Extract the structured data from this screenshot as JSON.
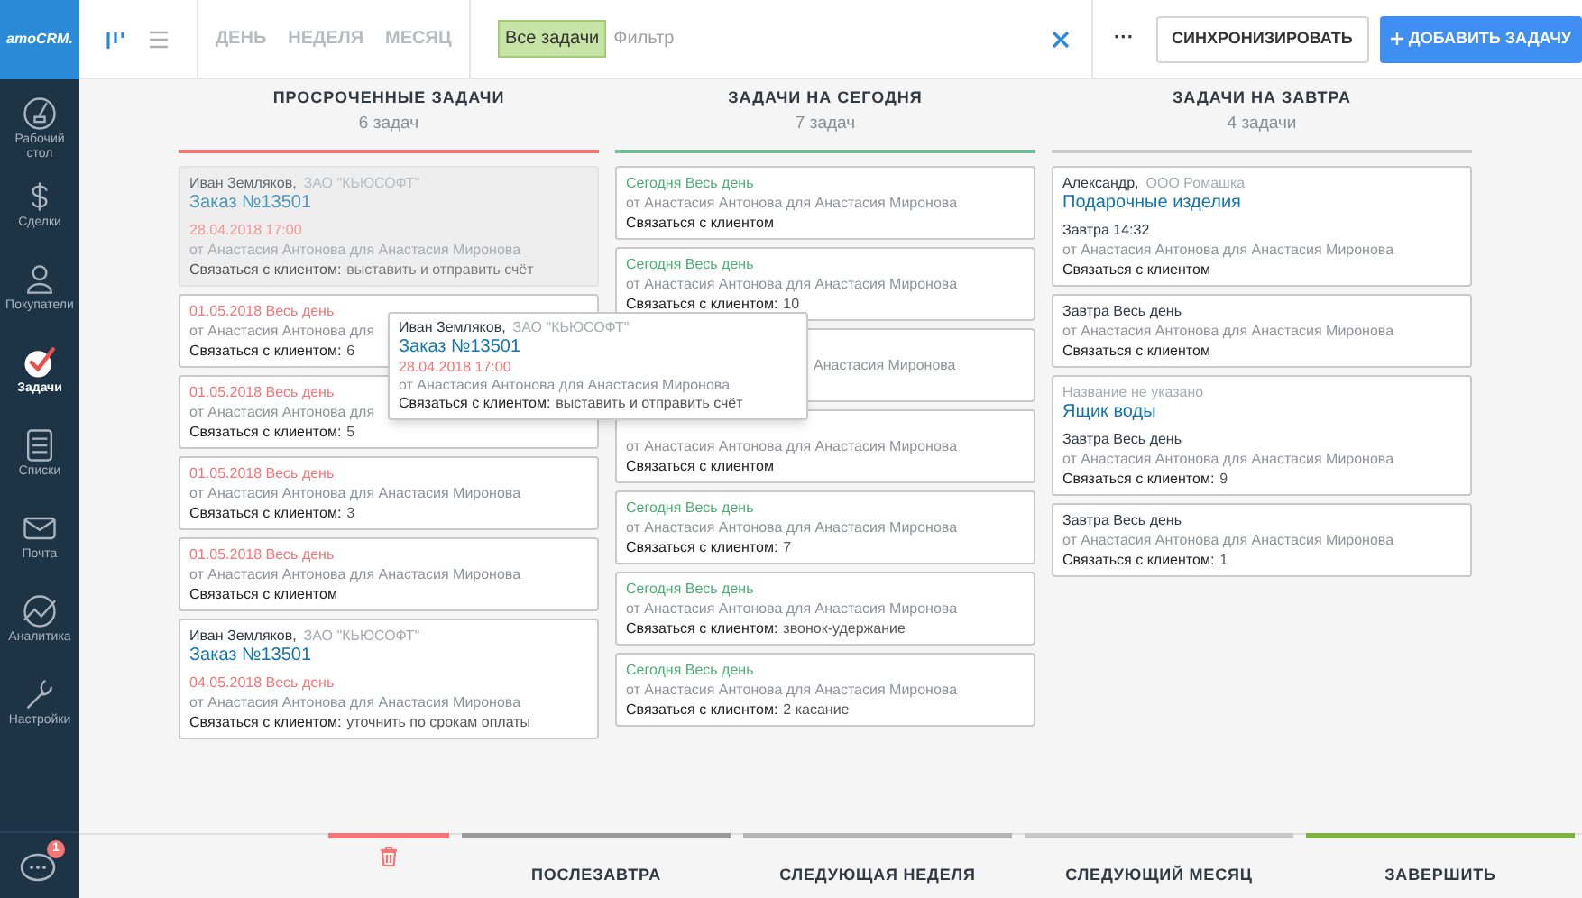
{
  "sidebar": {
    "logo": "amoCRM.",
    "items": [
      {
        "label": "Рабочий стол",
        "selected": false
      },
      {
        "label": "Сделки",
        "selected": false
      },
      {
        "label": "Покупатели",
        "selected": false
      },
      {
        "label": "Задачи",
        "selected": true
      },
      {
        "label": "Списки",
        "selected": false
      },
      {
        "label": "Почта",
        "selected": false
      },
      {
        "label": "Аналитика",
        "selected": false
      },
      {
        "label": "Настройки",
        "selected": false
      }
    ],
    "chat_badge": "1"
  },
  "toolbar": {
    "views": [
      {
        "selected": true
      },
      {
        "selected": false
      }
    ],
    "periods": [
      {
        "label": "ДЕНЬ",
        "selected": false
      },
      {
        "label": "НЕДЕЛЯ",
        "selected": false
      },
      {
        "label": "МЕСЯЦ",
        "selected": false
      }
    ],
    "filter": {
      "tag": "Все задачи",
      "placeholder": "Фильтр"
    },
    "more": "···",
    "sync_button": "СИНХРОНИЗИРОВАТЬ",
    "add_button": "ДОБАВИТЬ ЗАДАЧУ"
  },
  "columns": [
    {
      "kind": "overdue",
      "title": "ПРОСРОЧЕННЫЕ ЗАДАЧИ",
      "count": "6 задач",
      "cards": [
        {
          "placeholder": true,
          "contact": "Иван Земляков,",
          "company": "ЗАО \"КЬЮСОФТ\"",
          "lead": "Заказ №13501",
          "date": "28.04.2018 17:00",
          "from": "от Анастасия Антонова для Анастасия Миронова",
          "task": "Связаться с клиентом:",
          "comment": "выставить и отправить счёт"
        },
        {
          "placeholder": false,
          "date": "01.05.2018 Весь день",
          "from": "от Анастасия Антонова для",
          "task": "Связаться с клиентом:",
          "comment": "6"
        },
        {
          "placeholder": false,
          "date": "01.05.2018 Весь день",
          "from": "от Анастасия Антонова для",
          "task": "Связаться с клиентом:",
          "comment": "5"
        },
        {
          "placeholder": false,
          "date": "01.05.2018 Весь день",
          "from": "от Анастасия Антонова для Анастасия Миронова",
          "task": "Связаться с клиентом:",
          "comment": "3"
        },
        {
          "placeholder": false,
          "date": "01.05.2018 Весь день",
          "from": "от Анастасия Антонова для Анастасия Миронова",
          "task": "Связаться с клиентом"
        },
        {
          "placeholder": false,
          "contact": "Иван Земляков,",
          "company": "ЗАО \"КЬЮСОФТ\"",
          "lead": "Заказ №13501",
          "date": "04.05.2018 Весь день",
          "from": "от Анастасия Антонова для Анастасия Миронова",
          "task": "Связаться с клиентом:",
          "comment": "уточнить по срокам оплаты"
        }
      ]
    },
    {
      "kind": "today",
      "title": "ЗАДАЧИ НА СЕГОДНЯ",
      "count": "7 задач",
      "cards": [
        {
          "placeholder": false,
          "date": "Сегодня Весь день",
          "from": "от Анастасия Антонова для Анастасия Миронова",
          "task": "Связаться с клиентом"
        },
        {
          "placeholder": false,
          "date": "Сегодня Весь день",
          "from": "от Анастасия Антонова для Анастасия Миронова",
          "task": "Связаться с клиентом:",
          "comment": "10"
        },
        {
          "placeholder": false,
          "covered": true,
          "from": "Анастасия Миронова"
        },
        {
          "placeholder": false,
          "from": "от Анастасия Антонова для Анастасия Миронова",
          "task": "Связаться с клиентом"
        },
        {
          "placeholder": false,
          "date": "Сегодня Весь день",
          "from": "от Анастасия Антонова для Анастасия Миронова",
          "task": "Связаться с клиентом:",
          "comment": "7"
        },
        {
          "placeholder": false,
          "date": "Сегодня Весь день",
          "from": "от Анастасия Антонова для Анастасия Миронова",
          "task": "Связаться с клиентом:",
          "comment": "звонок-удержание"
        },
        {
          "placeholder": false,
          "date": "Сегодня Весь день",
          "from": "от Анастасия Антонова для Анастасия Миронова",
          "task": "Связаться с клиентом:",
          "comment": "2 касание"
        }
      ]
    },
    {
      "kind": "tomorrow",
      "title": "ЗАДАЧИ НА ЗАВТРА",
      "count": "4 задачи",
      "cards": [
        {
          "placeholder": false,
          "contact": "Александр,",
          "company": "ООО Ромашка",
          "lead": "Подарочные изделия",
          "date": "Завтра 14:32",
          "from": "от Анастасия Антонова для Анастасия Миронова",
          "task": "Связаться с клиентом"
        },
        {
          "placeholder": false,
          "date": "Завтра Весь день",
          "from": "от Анастасия Антонова для Анастасия Миронова",
          "task": "Связаться с клиентом"
        },
        {
          "placeholder": false,
          "company": "Название не указано",
          "lead": "Ящик воды",
          "date": "Завтра Весь день",
          "from": "от Анастасия Антонова для Анастасия Миронова",
          "task": "Связаться с клиентом:",
          "comment": "9"
        },
        {
          "placeholder": false,
          "date": "Завтра Весь день",
          "from": "от Анастасия Антонова для Анастасия Миронова",
          "task": "Связаться с клиентом:",
          "comment": "1"
        }
      ]
    }
  ],
  "dragged_card": {
    "contact": "Иван Земляков,",
    "company": "ЗАО \"КЬЮСОФТ\"",
    "lead": "Заказ №13501",
    "date": "28.04.2018 17:00",
    "from": "от Анастасия Антонова для Анастасия Миронова",
    "task": "Связаться с клиентом:",
    "comment": "выставить и отправить счёт"
  },
  "drop_zones": [
    {
      "kind": "delete"
    },
    {
      "kind": "move",
      "label": "ПОСЛЕЗАВТРА",
      "color": "#9a9a9a"
    },
    {
      "kind": "move",
      "label": "СЛЕДУЮЩАЯ НЕДЕЛЯ",
      "color": "#b5b5b5"
    },
    {
      "kind": "move",
      "label": "СЛЕДУЮЩИЙ МЕСЯЦ",
      "color": "#c8c8c8"
    },
    {
      "kind": "complete",
      "label": "ЗАВЕРШИТЬ",
      "color": "#7cb342"
    }
  ]
}
